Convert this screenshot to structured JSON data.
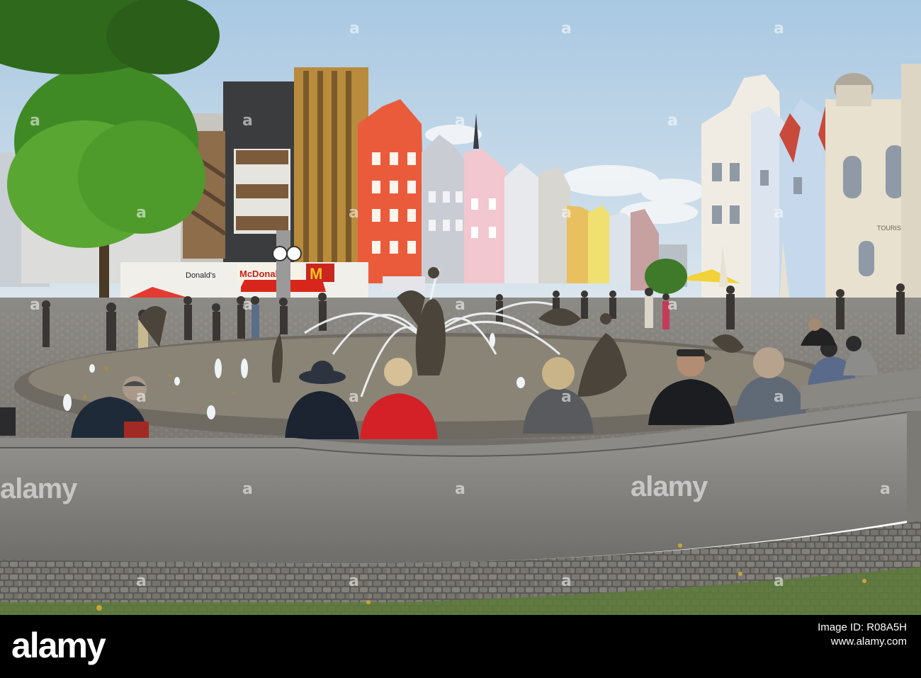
{
  "image": {
    "description_colors": {
      "sky": "#cfe0ec",
      "tree": "#4f9a2c",
      "red_house": "#e8563a",
      "stone": "#8a8a88",
      "footer": "#000000"
    }
  },
  "storefront": {
    "mcdonalds_sign_left": "Donald's",
    "mcdonalds_sign_main": "McDonald's",
    "mcdonalds_logo": "M"
  },
  "tourist_info_sign": "TOURISTINFORMATION",
  "watermark": {
    "text": "alamy",
    "mark": "a"
  },
  "footer": {
    "logo": "alamy",
    "image_id_label": "Image ID: R08A5H",
    "site": "www.alamy.com"
  }
}
